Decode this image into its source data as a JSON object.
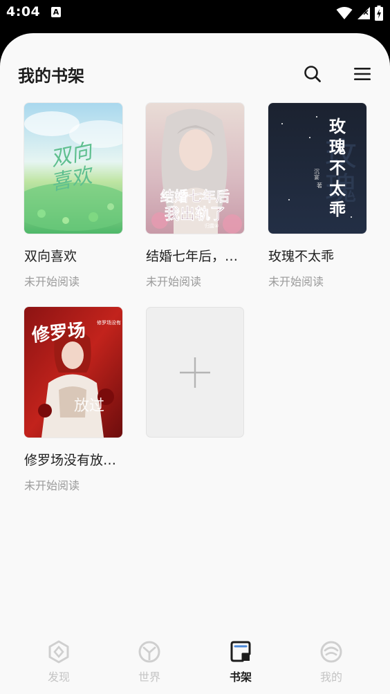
{
  "status_bar": {
    "time": "4:04",
    "notification_letter": "A"
  },
  "header": {
    "title": "我的书架",
    "search_icon": "search-icon",
    "menu_icon": "menu-icon"
  },
  "books": [
    {
      "title": "双向喜欢",
      "status": "未开始阅读",
      "cover_text": "双向\n喜欢",
      "cover_small": ""
    },
    {
      "title": "结婚七年后，…",
      "status": "未开始阅读",
      "cover_text": "结婚七年后",
      "cover_text2": "我出轨了",
      "cover_small": "归露④"
    },
    {
      "title": "玫瑰不太乖",
      "status": "未开始阅读",
      "cover_text": "玫瑰不太乖",
      "cover_small": "沉宴 著"
    },
    {
      "title": "修罗场没有放…",
      "status": "未开始阅读",
      "cover_text": "修罗场没有放过我"
    }
  ],
  "add_book": {
    "icon": "plus-icon"
  },
  "nav": {
    "items": [
      {
        "label": "发现",
        "icon": "discover-icon",
        "active": false
      },
      {
        "label": "世界",
        "icon": "world-icon",
        "active": false
      },
      {
        "label": "书架",
        "icon": "bookshelf-icon",
        "active": true
      },
      {
        "label": "我的",
        "icon": "profile-icon",
        "active": false
      }
    ]
  },
  "colors": {
    "panel": "#f9f9f9",
    "active_nav": "#1d1d1d",
    "inactive_nav": "#c4c4c4",
    "status_text": "#9a9a9a"
  }
}
